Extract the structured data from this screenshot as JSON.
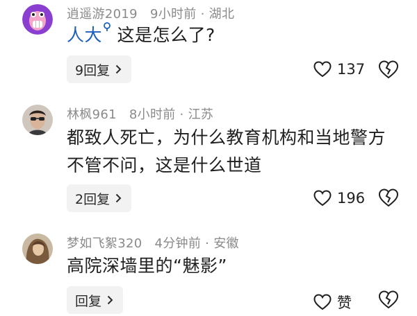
{
  "comments": [
    {
      "username": "逍遥游2019",
      "time": "9小时前",
      "location": "湖北",
      "mention": "人大",
      "text_lines": [
        "这是怎么了?"
      ],
      "reply_label": "9回复",
      "likes": "137"
    },
    {
      "username": "林枫961",
      "time": "8小时前",
      "location": "江苏",
      "text_lines": [
        "都致人死亡，为什么教育机构和当地警方",
        "不管不问，这是什么世道"
      ],
      "reply_label": "2回复",
      "likes": "196"
    },
    {
      "username": "梦如飞絮320",
      "time": "4分钟前",
      "location": "安徽",
      "text_lines": [
        "高院深墙里的“魅影”"
      ],
      "reply_label": "回复",
      "likes": "赞"
    }
  ],
  "separator": "·",
  "colors": {
    "mention": "#1d5fbf",
    "avatar1_bg": "#8a3fd1",
    "meta_text": "#8a8a8a",
    "reply_bg": "#f2f2f2"
  },
  "icons": {
    "like": "heart-outline-icon",
    "dislike": "broken-heart-icon",
    "chevron": "chevron-right-icon",
    "mention": "search-icon"
  }
}
